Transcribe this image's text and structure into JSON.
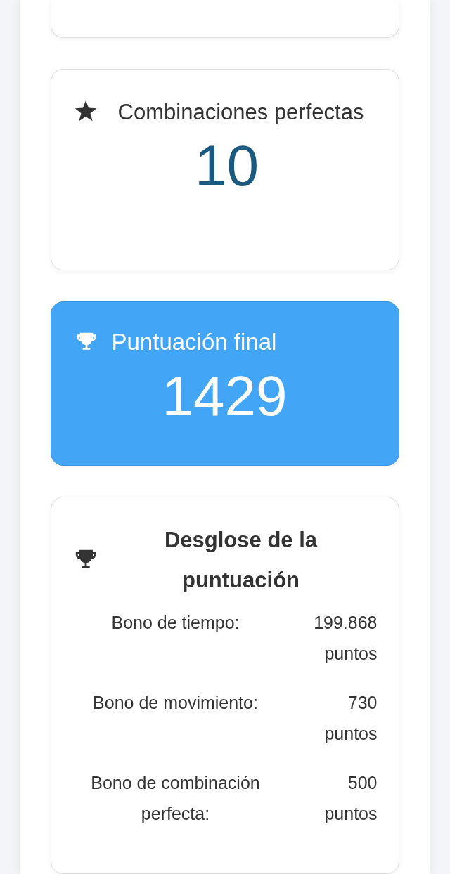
{
  "perfect_matches": {
    "title": "Combinaciones perfectas",
    "value": "10"
  },
  "final_score": {
    "title": "Puntuación final",
    "value": "1429"
  },
  "breakdown": {
    "title": "Desglose de la puntuación",
    "rows": [
      {
        "label": "Bono de tiempo:",
        "value": "199.868 puntos"
      },
      {
        "label": "Bono de movimiento:",
        "value": "730 puntos"
      },
      {
        "label": "Bono de combinación perfecta:",
        "value": "500 puntos"
      }
    ]
  }
}
